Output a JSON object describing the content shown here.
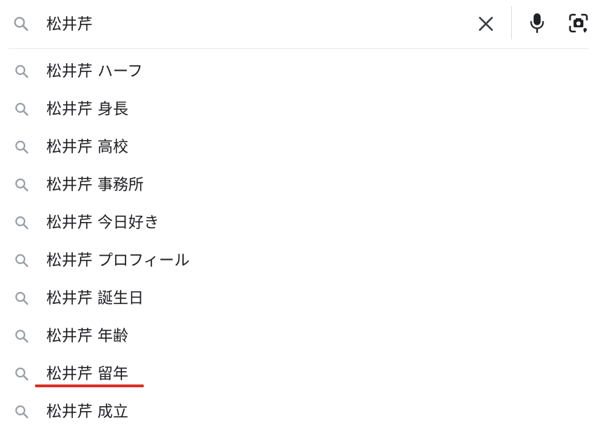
{
  "search": {
    "query": "松井芹",
    "clear_icon": "close-icon",
    "mic_icon": "microphone-icon",
    "lens_icon": "camera-lens-icon",
    "search_icon": "search-icon"
  },
  "suggestions": [
    {
      "text": "松井芹 ハーフ"
    },
    {
      "text": "松井芹 身長"
    },
    {
      "text": "松井芹 高校"
    },
    {
      "text": "松井芹 事務所"
    },
    {
      "text": "松井芹 今日好き"
    },
    {
      "text": "松井芹 プロフィール"
    },
    {
      "text": "松井芹 誕生日"
    },
    {
      "text": "松井芹 年齢"
    },
    {
      "text": "松井芹 留年"
    },
    {
      "text": "松井芹 成立"
    }
  ],
  "colors": {
    "text": "#202124",
    "icon_gray": "#70757a",
    "icon_dark": "#3c4043",
    "annotation_red": "#d93025",
    "divider": "#e8eaed"
  }
}
